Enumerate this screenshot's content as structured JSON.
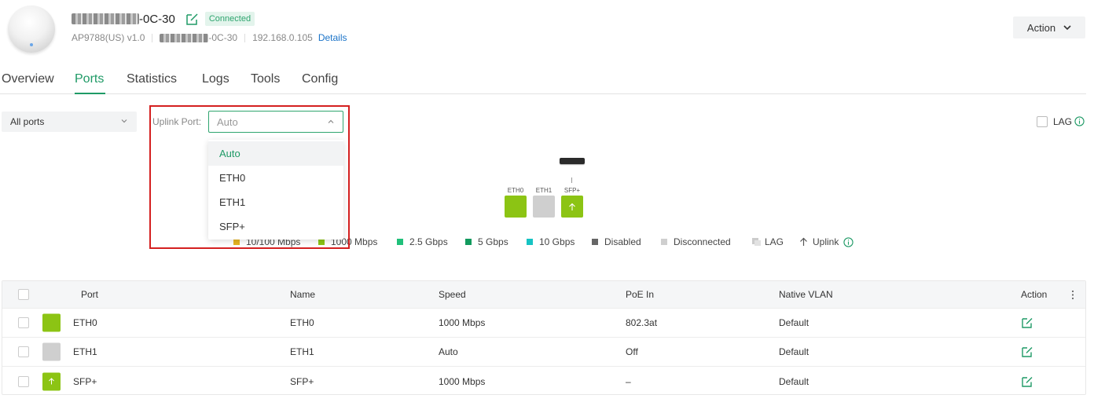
{
  "header": {
    "name_suffix": "-0C-30",
    "status": "Connected",
    "model": "AP9788(US) v1.0",
    "mac_suffix": "-0C-30",
    "ip": "192.168.0.105",
    "details_link": "Details",
    "action_button": "Action"
  },
  "tabs": [
    "Overview",
    "Ports",
    "Statistics",
    "Logs",
    "Tools",
    "Config"
  ],
  "active_tab": "Ports",
  "filters": {
    "all_ports": "All ports",
    "uplink_label": "Uplink Port:",
    "uplink_value": "Auto",
    "uplink_options": [
      "Auto",
      "ETH0",
      "ETH1",
      "SFP+"
    ],
    "lag_label": "LAG"
  },
  "diagram": {
    "ports": [
      {
        "label": "ETH0",
        "state": "1000 Mbps",
        "uplink": false
      },
      {
        "label": "ETH1",
        "state": "Disconnected",
        "uplink": false
      },
      {
        "label": "SFP+",
        "state": "1000 Mbps",
        "uplink": true
      }
    ]
  },
  "legend": [
    {
      "label": "10/100 Mbps",
      "color": "#e6b422"
    },
    {
      "label": "1000 Mbps",
      "color": "#8cc414"
    },
    {
      "label": "2.5 Gbps",
      "color": "#20c07a"
    },
    {
      "label": "5 Gbps",
      "color": "#129a5e"
    },
    {
      "label": "10 Gbps",
      "color": "#16c3c3"
    },
    {
      "label": "Disabled",
      "color": "#666666"
    },
    {
      "label": "Disconnected",
      "color": "#cfcfcf"
    },
    {
      "label": "LAG",
      "color": "#cccccc"
    },
    {
      "label": "Uplink",
      "color": "#555555"
    }
  ],
  "table": {
    "headers": {
      "port": "Port",
      "name": "Name",
      "speed": "Speed",
      "poe_in": "PoE In",
      "native_vlan": "Native VLAN",
      "action": "Action"
    },
    "rows": [
      {
        "port": "ETH0",
        "name": "ETH0",
        "speed": "1000 Mbps",
        "poe_in": "802.3at",
        "native_vlan": "Default",
        "color": "#8cc414",
        "uplink": false
      },
      {
        "port": "ETH1",
        "name": "ETH1",
        "speed": "Auto",
        "poe_in": "Off",
        "native_vlan": "Default",
        "color": "#cfcfcf",
        "uplink": false
      },
      {
        "port": "SFP+",
        "name": "SFP+",
        "speed": "1000 Mbps",
        "poe_in": "–",
        "native_vlan": "Default",
        "color": "#8cc414",
        "uplink": true
      }
    ]
  },
  "colors": {
    "accent": "#1f9a66",
    "link": "#1a73c8",
    "highlight": "#d42020"
  }
}
